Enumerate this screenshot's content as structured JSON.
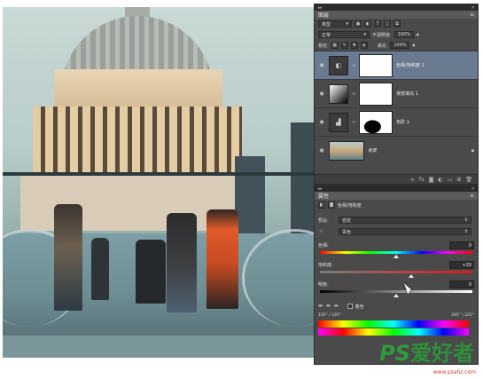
{
  "layers_panel": {
    "tab_title": "图层",
    "filter_kind": "类型",
    "blend_mode": "正常",
    "opacity_label": "不透明度:",
    "opacity_value": "100%",
    "lock_label": "锁定:",
    "fill_label": "填充:",
    "fill_value": "100%",
    "layers": [
      {
        "name": "色相/饱和度 1",
        "thumb_icon": "hue-saturation-icon",
        "mask": "white",
        "selected": true
      },
      {
        "name": "渐变填充 1",
        "thumb_icon": "gradient-fill-icon",
        "mask": "white",
        "selected": false
      },
      {
        "name": "色阶 1",
        "thumb_icon": "levels-icon",
        "mask": "levels-mask",
        "selected": false
      },
      {
        "name": "背景",
        "thumb_icon": "photo-thumbnail",
        "mask": null,
        "selected": false
      }
    ]
  },
  "properties_panel": {
    "tab_title": "属性",
    "adjustment_title": "色相/饱和度",
    "preset_label": "预设:",
    "preset_value": "自定",
    "channel_value": "青色",
    "hue_label": "色相:",
    "hue_value": "0",
    "saturation_label": "饱和度:",
    "saturation_value": "+20",
    "lightness_label": "明度:",
    "lightness_value": "0",
    "colorize_label": "着色",
    "range_left": "165° / 165°",
    "range_right": "195° \\ 225°",
    "hue_slider_level": 0.5,
    "saturation_slider_level": 0.6,
    "lightness_slider_level": 0.5
  },
  "watermark": {
    "text_ps": "PS",
    "text_cn": "爱好者",
    "url": "www.psahz.com"
  },
  "colors": {
    "panel_bg": "#4a4a4a",
    "selected_layer": "#6a7b91",
    "watermark_green": "#2f8f3a"
  }
}
